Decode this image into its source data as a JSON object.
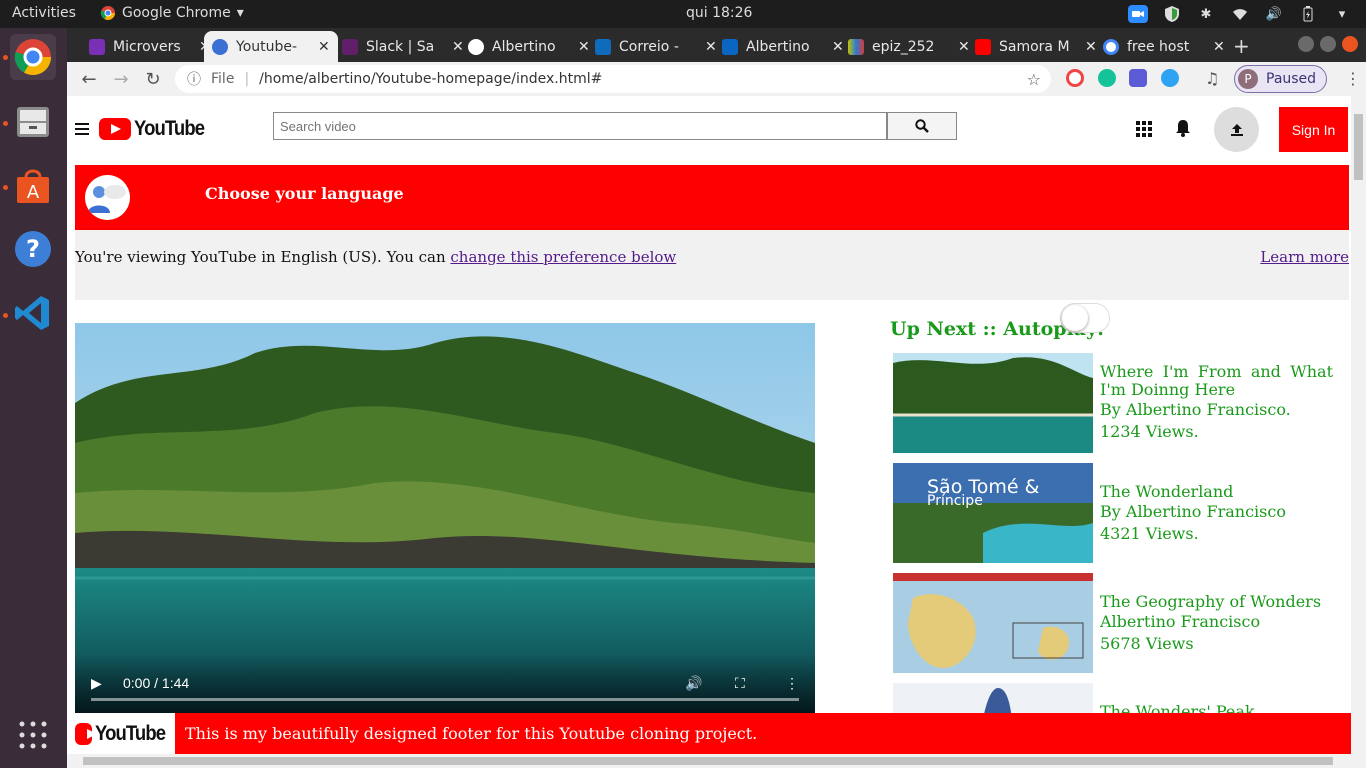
{
  "topbar": {
    "activities": "Activities",
    "app_name": "Google Chrome",
    "clock": "qui 18:26"
  },
  "tabs": [
    {
      "label": "Microvers",
      "color": "#7b2fb5"
    },
    {
      "label": "Youtube-",
      "color": "#3b6fd4",
      "active": true
    },
    {
      "label": "Slack | Sa",
      "color": "#611f69"
    },
    {
      "label": "Albertino",
      "color": "#ffffff"
    },
    {
      "label": "Correio -",
      "color": "#0f6cbd"
    },
    {
      "label": "Albertino",
      "color": "#0a66c2"
    },
    {
      "label": "epiz_252",
      "color": "#c4c400"
    },
    {
      "label": "Samora M",
      "color": "#ff0000"
    },
    {
      "label": "free host",
      "color": "#4285f4"
    }
  ],
  "toolbar": {
    "file_label": "File",
    "url": "/home/albertino/Youtube-homepage/index.html#",
    "profile_initial": "P",
    "profile_label": "Paused"
  },
  "header": {
    "logo_text": "YouTube",
    "search_placeholder": "Search video",
    "signin_label": "Sign In"
  },
  "language": {
    "title": "Choose your language",
    "info_text": "You're viewing YouTube in English (US). You can ",
    "change_link": "change this preference below",
    "learn_more": "Learn more"
  },
  "video": {
    "time": "0:00 / 1:44",
    "progress": 0
  },
  "upnext": {
    "title": "Up Next :: Autoplay:",
    "autoplay_on": false,
    "items": [
      {
        "title": "Where I'm From and What I'm Doinng Here",
        "author": "By Albertino Francisco.",
        "views": "1234 Views."
      },
      {
        "title": "The Wonderland",
        "author": "By Albertino Francisco",
        "views": "4321 Views."
      },
      {
        "title": "The Geography of Wonders",
        "author": "Albertino Francisco",
        "views": "5678 Views"
      },
      {
        "title": "The Wonders' Peak",
        "author": "",
        "views": ""
      }
    ]
  },
  "footer": {
    "logo_text": "YouTube",
    "text": "This is my beautifully designed footer for this Youtube cloning project."
  },
  "colors": {
    "brand_red": "#ff0000",
    "link_green": "#1a9a1a",
    "dock_bg": "#3a2c39"
  }
}
